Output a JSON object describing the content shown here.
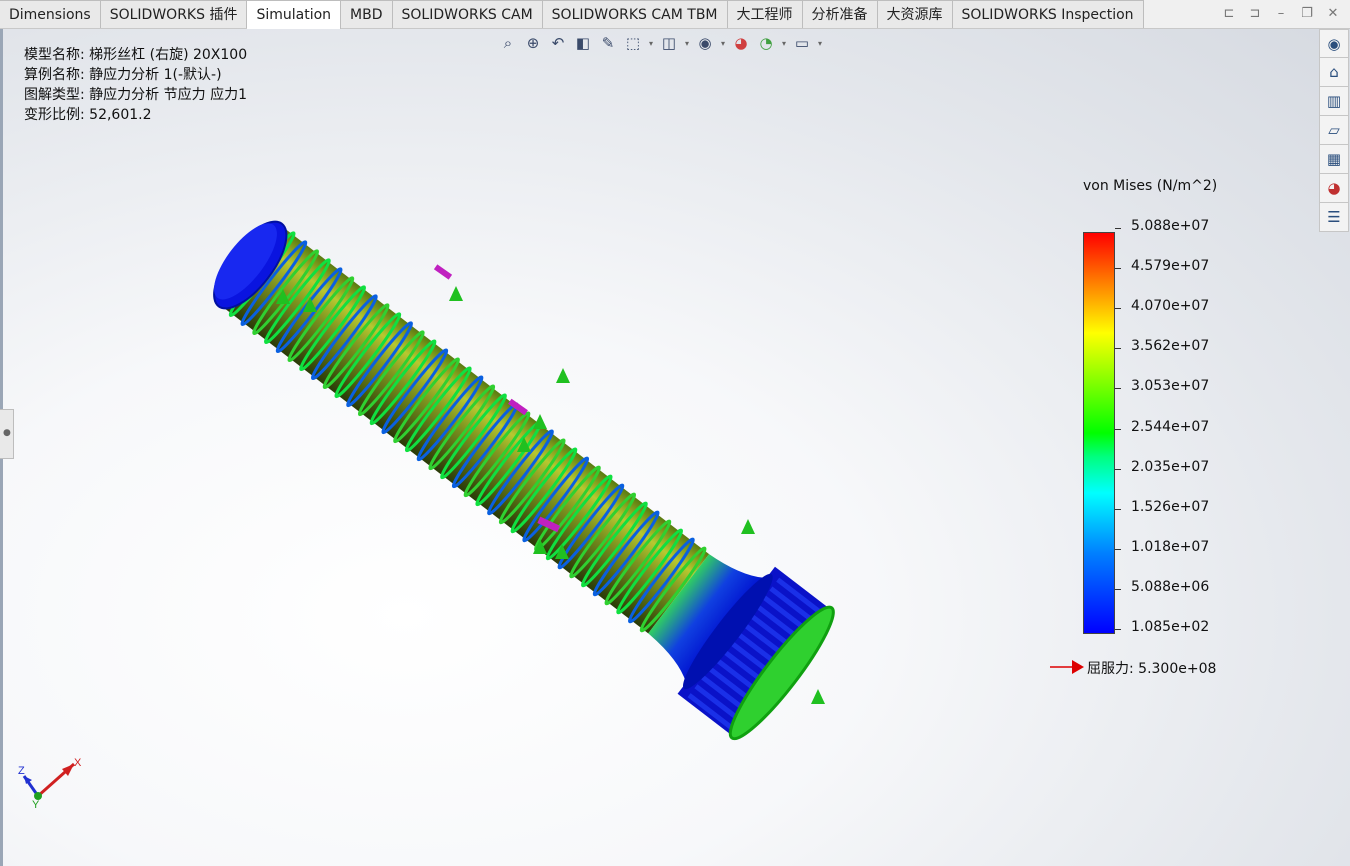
{
  "tabs": [
    {
      "label": "Dimensions",
      "active": false
    },
    {
      "label": "SOLIDWORKS 插件",
      "active": false
    },
    {
      "label": "Simulation",
      "active": true
    },
    {
      "label": "MBD",
      "active": false
    },
    {
      "label": "SOLIDWORKS CAM",
      "active": false
    },
    {
      "label": "SOLIDWORKS CAM TBM",
      "active": false
    },
    {
      "label": "大工程师",
      "active": false
    },
    {
      "label": "分析准备",
      "active": false
    },
    {
      "label": "大资源库",
      "active": false
    },
    {
      "label": "SOLIDWORKS Inspection",
      "active": false
    }
  ],
  "info": {
    "model_name": "模型名称: 梯形丝杠 (右旋) 20X100",
    "study_name": "算例名称: 静应力分析 1(-默认-)",
    "plot_type": "图解类型: 静应力分析 节应力 应力1",
    "deformation_scale": "变形比例: 52,601.2"
  },
  "legend": {
    "title": "von Mises (N/m^2)",
    "values": [
      "5.088e+07",
      "4.579e+07",
      "4.070e+07",
      "3.562e+07",
      "3.053e+07",
      "2.544e+07",
      "2.035e+07",
      "1.526e+07",
      "1.018e+07",
      "5.088e+06",
      "1.085e+02"
    ],
    "yield_label": "屈服力: 5.300e+08",
    "colors": {
      "max": "#ff0000",
      "mid": "#00ff00",
      "min": "#0000ff",
      "arrow": "#dd0000"
    }
  },
  "triad": {
    "x": "X",
    "y": "Y",
    "z": "Z"
  },
  "hud_icons": [
    "zoom-to-fit-icon",
    "zoom-to-area-icon",
    "previous-view-icon",
    "section-view-icon",
    "dynamic-annotation-icon",
    "view-orientation-icon",
    "display-style-icon",
    "hide-show-icon",
    "edit-appearance-icon",
    "apply-scene-icon",
    "view-settings-icon"
  ],
  "taskpane_icons": [
    "solidworks-resources-icon",
    "home-icon",
    "design-library-icon",
    "file-explorer-icon",
    "view-palette-icon",
    "appearances-icon",
    "custom-properties-icon"
  ]
}
